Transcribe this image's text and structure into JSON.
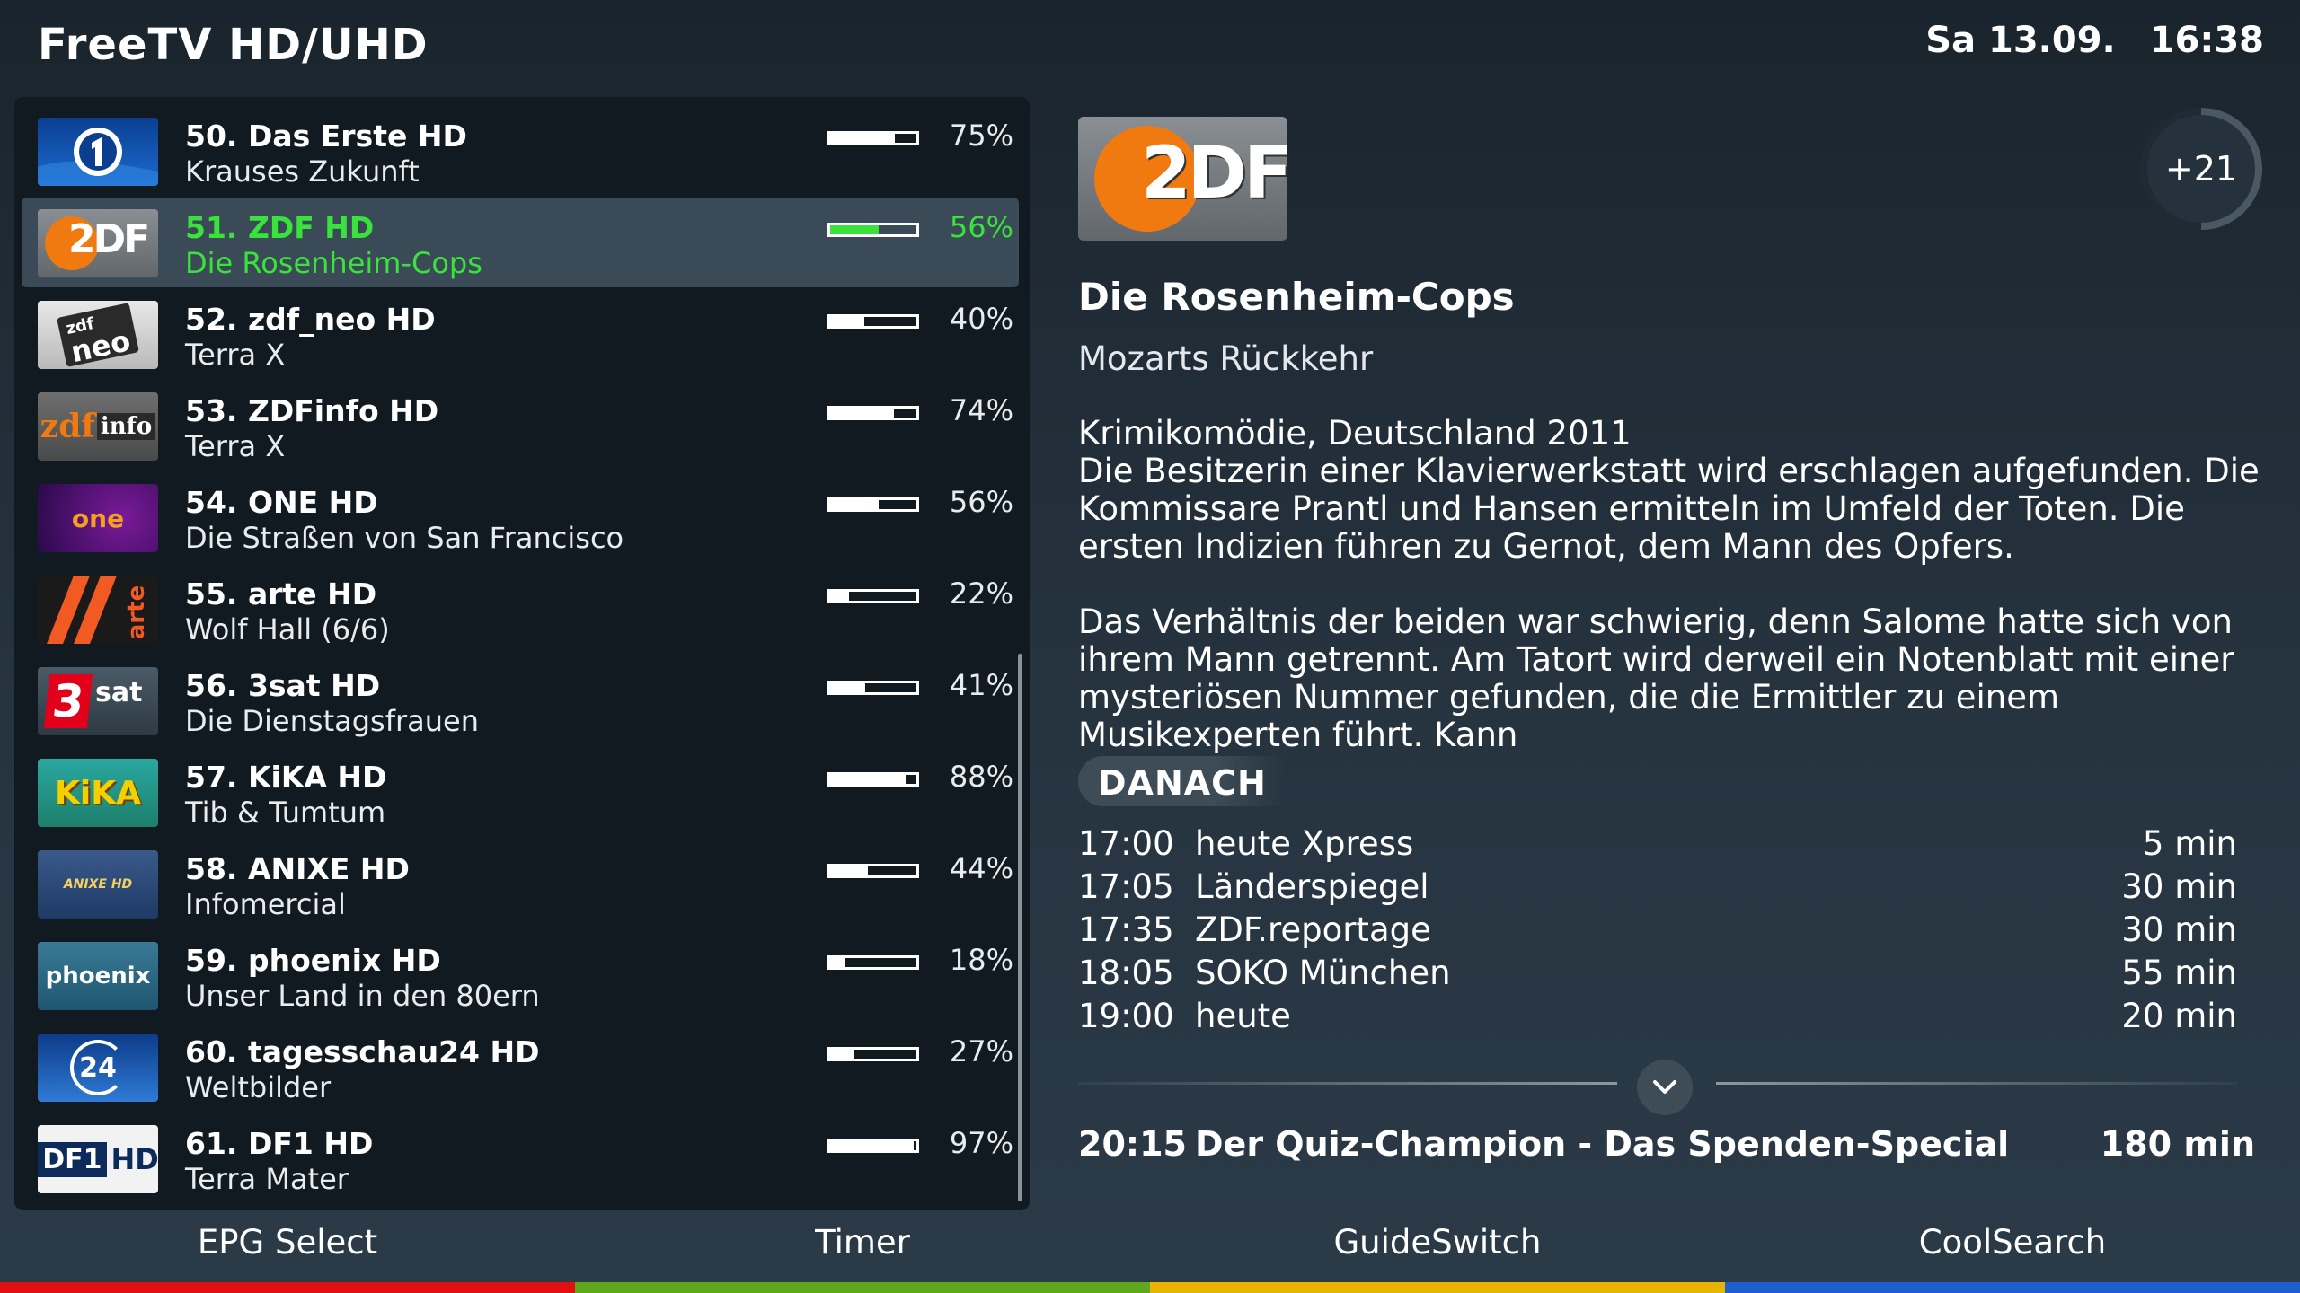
{
  "header": {
    "title": "FreeTV HD/UHD",
    "date": "Sa 13.09.",
    "time": "16:38"
  },
  "channels": [
    {
      "name": "50. Das Erste HD",
      "program": "Krauses Zukunft",
      "progress": 0.75,
      "percent": "75%",
      "logo": "das-erste-logo",
      "selected": false
    },
    {
      "name": "51. ZDF HD",
      "program": "Die Rosenheim-Cops",
      "progress": 0.56,
      "percent": "56%",
      "logo": "zdf-logo",
      "selected": true
    },
    {
      "name": "52. zdf_neo HD",
      "program": "Terra X",
      "progress": 0.4,
      "percent": "40%",
      "logo": "zdfneo-logo",
      "selected": false
    },
    {
      "name": "53. ZDFinfo HD",
      "program": "Terra X",
      "progress": 0.74,
      "percent": "74%",
      "logo": "zdfinfo-logo",
      "selected": false
    },
    {
      "name": "54. ONE HD",
      "program": "Die Straßen von San Francisco",
      "progress": 0.56,
      "percent": "56%",
      "logo": "one-logo",
      "selected": false
    },
    {
      "name": "55. arte HD",
      "program": "Wolf Hall (6/6)",
      "progress": 0.22,
      "percent": "22%",
      "logo": "arte-logo",
      "selected": false
    },
    {
      "name": "56. 3sat HD",
      "program": "Die Dienstagsfrauen",
      "progress": 0.41,
      "percent": "41%",
      "logo": "3sat-logo",
      "selected": false
    },
    {
      "name": "57. KiKA HD",
      "program": "Tib & Tumtum",
      "progress": 0.88,
      "percent": "88%",
      "logo": "kika-logo",
      "selected": false
    },
    {
      "name": "58. ANIXE HD",
      "program": "Infomercial",
      "progress": 0.44,
      "percent": "44%",
      "logo": "anixe-logo",
      "selected": false
    },
    {
      "name": "59. phoenix HD",
      "program": "Unser Land in den 80ern",
      "progress": 0.18,
      "percent": "18%",
      "logo": "phoenix-logo",
      "selected": false
    },
    {
      "name": "60. tagesschau24 HD",
      "program": "Weltbilder",
      "progress": 0.27,
      "percent": "27%",
      "logo": "tagesschau24-logo",
      "selected": false
    },
    {
      "name": "61. DF1 HD",
      "program": "Terra Mater",
      "progress": 0.97,
      "percent": "97%",
      "logo": "df1-logo",
      "selected": false
    }
  ],
  "logo_texts": {
    "zdf": "2DF",
    "zdfneo_small": "zdf",
    "zdfneo": "neo",
    "zdfinfo_a": "zdf",
    "zdfinfo_b": "info",
    "one": "one",
    "arte": "arte",
    "sat_num": "3",
    "sat_txt": "sat",
    "kika": "KiKA",
    "anixe": "ANIXE HD",
    "phoenix": "phoenix",
    "t24": "24",
    "df1": "DF1",
    "df1_hd": "HD"
  },
  "detail": {
    "logo": "zdf-logo",
    "logo_text": "2DF",
    "rating": "+21",
    "title": "Die Rosenheim-Cops",
    "episode": "Mozarts Rückkehr",
    "genre_line": "Krimikomödie, Deutschland 2011",
    "paragraph1": "Die Besitzerin einer Klavierwerkstatt wird erschlagen aufgefunden. Die Kommissare Prantl und Hansen ermitteln im Umfeld der Toten. Die ersten Indizien führen zu Gernot, dem Mann des Opfers.",
    "paragraph2": "Das Verhältnis der beiden war schwierig, denn Salome hatte sich von ihrem Mann getrennt. Am Tatort wird derweil ein Notenblatt mit einer mysteriösen Nummer gefunden, die die Ermittler zu einem Musikexperten führt. Kann",
    "next_label": "DANACH",
    "schedule": [
      {
        "time": "17:00",
        "title": "heute Xpress",
        "duration": "5 min"
      },
      {
        "time": "17:05",
        "title": "Länderspiegel",
        "duration": "30 min"
      },
      {
        "time": "17:35",
        "title": "ZDF.reportage",
        "duration": "30 min"
      },
      {
        "time": "18:05",
        "title": "SOKO München",
        "duration": "55 min"
      },
      {
        "time": "19:00",
        "title": "heute",
        "duration": "20 min"
      }
    ],
    "expand_icon": "chevron-down-icon",
    "prime": {
      "time": "20:15",
      "title": "Der Quiz-Champion - Das Spenden-Special",
      "duration": "180 min"
    }
  },
  "footer": {
    "buttons": [
      {
        "label": "EPG Select",
        "color": "#e01010"
      },
      {
        "label": "Timer",
        "color": "#5fa81e"
      },
      {
        "label": "GuideSwitch",
        "color": "#e8b400"
      },
      {
        "label": "CoolSearch",
        "color": "#1e5fd0"
      }
    ]
  }
}
